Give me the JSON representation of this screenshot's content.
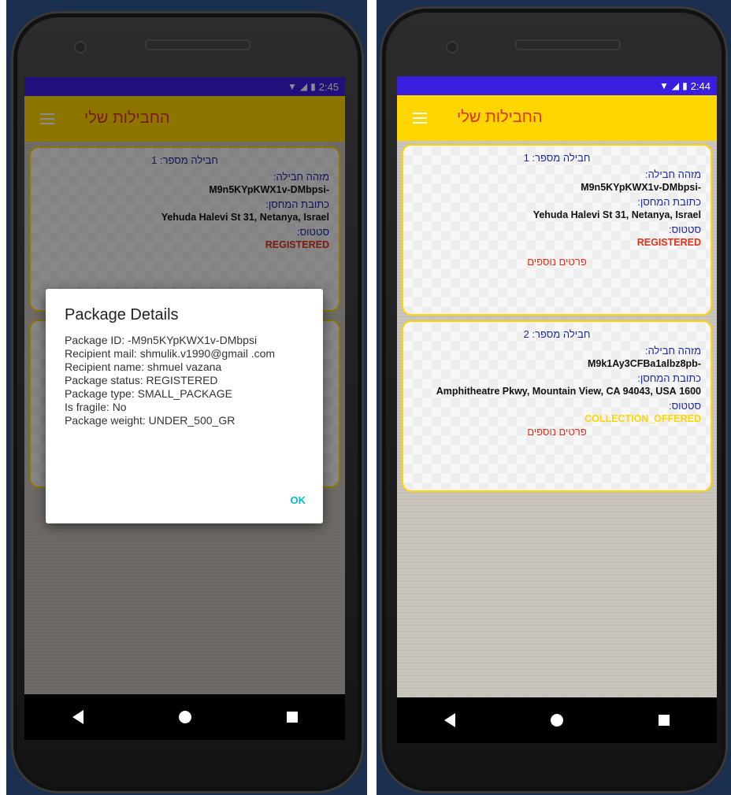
{
  "left_screen": {
    "status_time": "2:45",
    "app_title": "החבילות שלי",
    "card1": {
      "title": "חבילה מספר: 1",
      "id_label": "מזהה חבילה:",
      "id_value": "-M9n5KYpKWX1v-DMbpsi",
      "address_label": "כתובת המחסן:",
      "address_value": "Yehuda Halevi St 31, Netanya, Israel",
      "status_label": "סטטוס:",
      "status_value": "REGISTERED"
    },
    "dialog": {
      "title": "Package Details",
      "lines": [
        "Package ID: -M9n5KYpKWX1v-DMbpsi",
        "Recipient mail: shmulik.v1990@gmail .com",
        "Recipient name: shmuel vazana",
        "Package status: REGISTERED",
        "Package type: SMALL_PACKAGE",
        "Is fragile: No",
        "Package weight: UNDER_500_GR"
      ],
      "ok_label": "OK"
    }
  },
  "right_screen": {
    "status_time": "2:44",
    "app_title": "החבילות שלי",
    "cards": [
      {
        "title": "חבילה מספר: 1",
        "id_label": "מזהה חבילה:",
        "id_value": "-M9n5KYpKWX1v-DMbpsi",
        "address_label": "כתובת המחסן:",
        "address_value": "Yehuda Halevi St 31, Netanya, Israel",
        "status_label": "סטטוס:",
        "status_value": "REGISTERED",
        "more_label": "פרטים נוספים"
      },
      {
        "title": "חבילה מספר: 2",
        "id_label": "מזהה חבילה:",
        "id_value": "-M9k1Ay3CFBa1albz8pb",
        "address_label": "כתובת המחסן:",
        "address_value": "1600 Amphitheatre Pkwy, Mountain View, CA 94043, USA",
        "status_label": "סטטוס:",
        "status_value": "COLLECTION_OFFERED",
        "more_label": "פרטים נוספים"
      }
    ]
  },
  "colors": {
    "status_bar": "#3a1ee0",
    "app_bar": "#ffd600",
    "title_red": "#e0311b",
    "label_blue": "#1f2a9c",
    "registered_red": "#e0311b",
    "offered_yellow": "#ffd600",
    "ok_cyan": "#00bcd4"
  }
}
